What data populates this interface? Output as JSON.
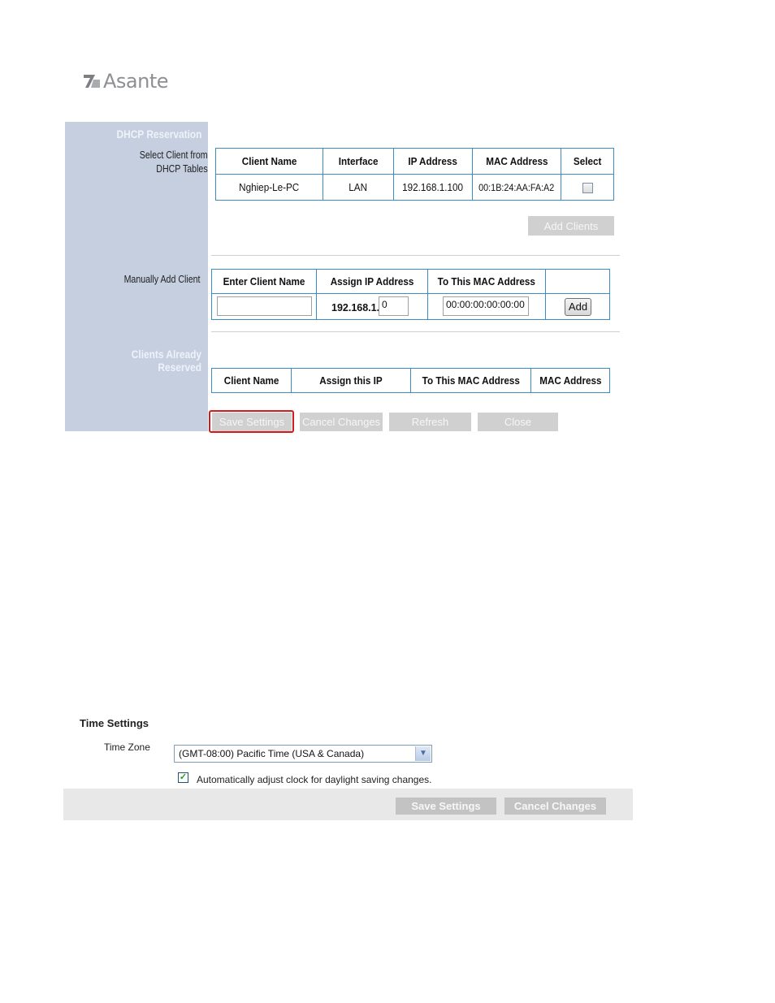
{
  "logo": {
    "text": "Asante"
  },
  "dhcp": {
    "section_title": "DHCP Reservation",
    "select_label_line1": "Select Client from",
    "select_label_line2": "DHCP Tables",
    "clients_table": {
      "headers": [
        "Client Name",
        "Interface",
        "IP Address",
        "MAC Address",
        "Select"
      ],
      "rows": [
        {
          "client_name": "Nghiep-Le-PC",
          "interface": "LAN",
          "ip": "192.168.1.100",
          "mac": "00:1B:24:AA:FA:A2",
          "selected": false
        }
      ]
    },
    "add_clients_label": "Add Clients",
    "manual_label": "Manually Add Client",
    "manual_table": {
      "headers": [
        "Enter Client Name",
        "Assign IP Address",
        "To This MAC Address",
        ""
      ],
      "client_name_value": "",
      "ip_prefix": "192.168.1.",
      "ip_last_octet": "0",
      "mac_value": "00:00:00:00:00:00",
      "add_label": "Add"
    },
    "reserved_title": "Clients Already Reserved",
    "reserved_table": {
      "headers": [
        "Client Name",
        "Assign this IP",
        "To This MAC Address",
        "MAC Address"
      ]
    },
    "buttons": {
      "save": "Save Settings",
      "cancel": "Cancel Changes",
      "refresh": "Refresh",
      "close": "Close"
    }
  },
  "time_settings": {
    "title": "Time Settings",
    "time_zone_label": "Time Zone",
    "time_zone_value": "(GMT-08:00) Pacific Time (USA & Canada)",
    "dst_checked": true,
    "dst_label": "Automatically adjust clock for daylight saving changes.",
    "save_label": "Save Settings",
    "cancel_label": "Cancel Changes"
  },
  "colors": {
    "sidebar": "#c5cfe0",
    "table_border": "#3c8dc4",
    "highlight": "#d01c1c",
    "disabled_button": "#d0d0d0"
  }
}
